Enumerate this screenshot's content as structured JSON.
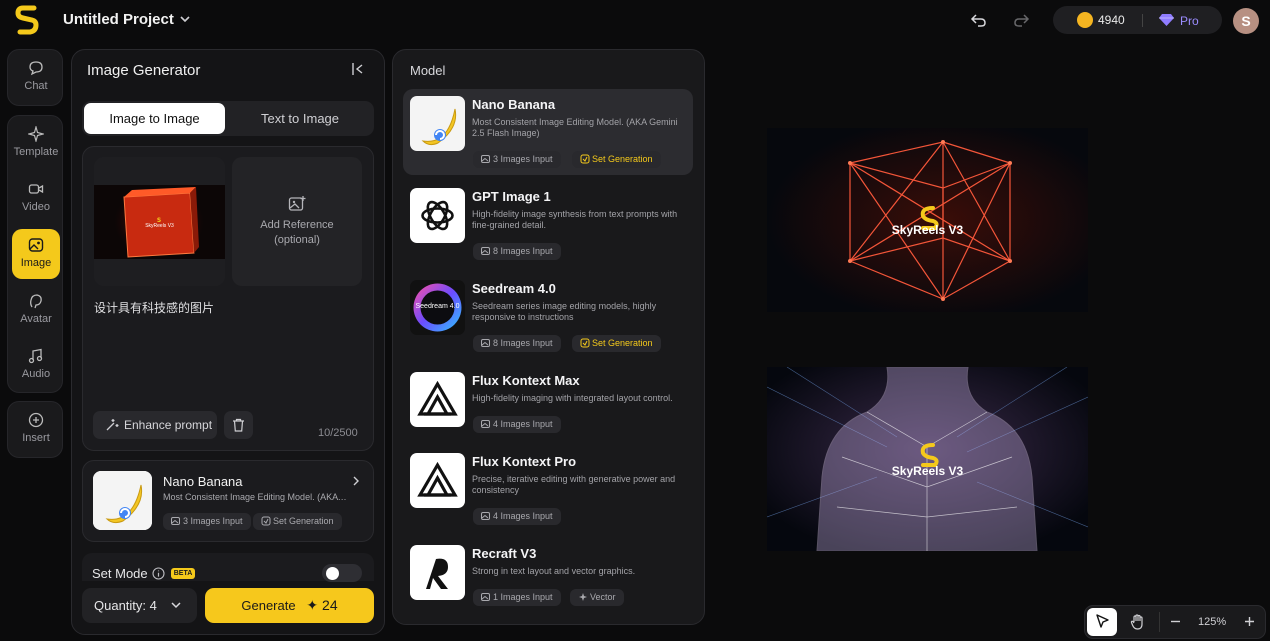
{
  "header": {
    "project_title": "Untitled Project",
    "credits": "4940",
    "plan": "Pro",
    "avatar_initial": "S"
  },
  "rail": {
    "chat": "Chat",
    "template": "Template",
    "video": "Video",
    "image": "Image",
    "avatar": "Avatar",
    "audio": "Audio",
    "insert": "Insert"
  },
  "generator": {
    "title": "Image Generator",
    "tabs": [
      "Image to Image",
      "Text to Image"
    ],
    "active_tab": "Image to Image",
    "add_reference": "Add Reference",
    "add_reference_optional": "(optional)",
    "reference_image_label": "SkyReels V3",
    "prompt": "设计具有科技感的图片",
    "enhance_label": "Enhance prompt",
    "char_count": "10/2500",
    "selected_model": {
      "name": "Nano Banana",
      "description": "Most Consistent Image Editing Model. (AKA Gemini 2.5 Flash Image)",
      "chips": [
        "3 Images Input",
        "Set Generation"
      ]
    },
    "set_mode_label": "Set Mode",
    "beta_label": "BETA",
    "set_mode_on": false,
    "quantity_label": "Quantity: 4",
    "generate_label": "Generate",
    "generate_cost": "✦ 24"
  },
  "models": {
    "title": "Model",
    "items": [
      {
        "name": "Nano Banana",
        "description": "Most Consistent Image Editing Model. (AKA Gemini 2.5 Flash Image)",
        "chips": [
          "3 Images Input",
          "Set Generation"
        ],
        "selected": true
      },
      {
        "name": "GPT Image 1",
        "description": "High-fidelity image synthesis from text prompts with fine-grained detail.",
        "chips": [
          "8 Images Input"
        ]
      },
      {
        "name": "Seedream 4.0",
        "description": "Seedream series image editing models, highly responsive to instructions",
        "chips": [
          "8 Images Input",
          "Set Generation"
        ],
        "thumb_text": "Seedream 4.0"
      },
      {
        "name": "Flux Kontext Max",
        "description": "High-fidelity imaging with integrated layout control.",
        "chips": [
          "4 Images Input"
        ]
      },
      {
        "name": "Flux Kontext Pro",
        "description": "Precise, iterative editing with generative power and consistency",
        "chips": [
          "4 Images Input"
        ]
      },
      {
        "name": "Recraft V3",
        "description": "Strong in text layout and vector graphics.",
        "chips": [
          "1 Images Input",
          "Vector"
        ]
      }
    ]
  },
  "canvas": {
    "image1_label": "SkyReels V3",
    "image2_label": "SkyReels V3",
    "zoom": "125%"
  },
  "colors": {
    "accent": "#f4c91b",
    "background": "#0b0b0c",
    "panel": "#141416",
    "pro": "#9b8cff"
  }
}
